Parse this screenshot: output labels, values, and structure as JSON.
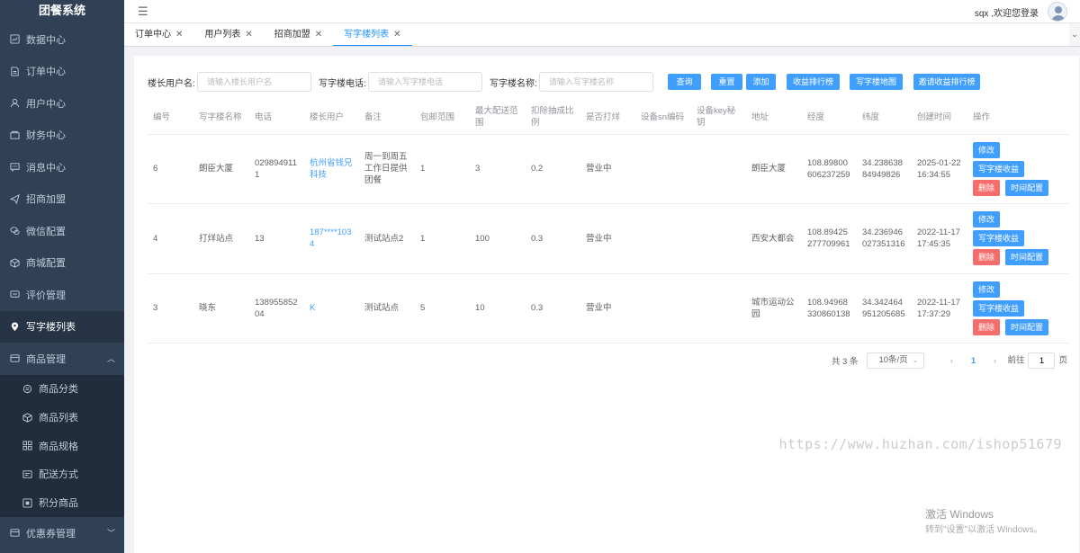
{
  "app_title": "团餐系统",
  "sidebar": {
    "items": [
      {
        "label": "数据中心",
        "icon": "dashboard-icon"
      },
      {
        "label": "订单中心",
        "icon": "document-icon"
      },
      {
        "label": "用户中心",
        "icon": "user-icon"
      },
      {
        "label": "财务中心",
        "icon": "wallet-icon"
      },
      {
        "label": "消息中心",
        "icon": "message-icon"
      },
      {
        "label": "招商加盟",
        "icon": "send-icon"
      },
      {
        "label": "微信配置",
        "icon": "wechat-icon"
      },
      {
        "label": "商城配置",
        "icon": "box-icon"
      },
      {
        "label": "评价管理",
        "icon": "comment-icon"
      },
      {
        "label": "写字楼列表",
        "icon": "location-icon"
      },
      {
        "label": "商品管理",
        "icon": "goods-icon"
      }
    ],
    "sub_items": [
      {
        "label": "商品分类",
        "icon": "category-icon"
      },
      {
        "label": "商品列表",
        "icon": "cube-icon"
      },
      {
        "label": "商品规格",
        "icon": "grid-icon"
      },
      {
        "label": "配送方式",
        "icon": "delivery-icon"
      },
      {
        "label": "积分商品",
        "icon": "points-icon"
      }
    ],
    "last_item": {
      "label": "优惠券管理",
      "icon": "coupon-icon"
    }
  },
  "header": {
    "welcome": "sqx ,欢迎您登录"
  },
  "tabs": [
    {
      "label": "订单中心"
    },
    {
      "label": "用户列表"
    },
    {
      "label": "招商加盟"
    },
    {
      "label": "写字楼列表"
    }
  ],
  "search": {
    "owner_label": "楼长用户名:",
    "owner_placeholder": "请输入楼长用户名",
    "phone_label": "写字楼电话:",
    "phone_placeholder": "请输入写字楼电话",
    "name_label": "写字楼名称:",
    "name_placeholder": "请输入写字楼名称",
    "buttons": {
      "query": "查询",
      "reset": "重置",
      "add": "添加",
      "revenue_rank": "收益排行榜",
      "map": "写字楼地图",
      "invite_rank": "邀请收益排行榜"
    }
  },
  "table": {
    "columns": [
      "编号",
      "写字楼名称",
      "电话",
      "楼长用户",
      "备注",
      "包邮范围",
      "最大配送范围",
      "扣除抽成比例",
      "是否打烊",
      "设备sn编码",
      "设备key秘钥",
      "地址",
      "经度",
      "纬度",
      "创建时间",
      "操作"
    ],
    "rows": [
      {
        "id": "6",
        "name": "朗臣大厦",
        "phone": "0298949111",
        "owner": "杭州省钱兄科技",
        "note": "周一到周五工作日提供团餐",
        "free_range": "1",
        "max_range": "3",
        "commission": "0.2",
        "status": "营业中",
        "sn": "",
        "key": "",
        "address": "朗臣大厦",
        "lng": "108.89800606237259",
        "lat": "34.23863884949826",
        "created": "2025-01-22 16:34:55"
      },
      {
        "id": "4",
        "name": "打烊站点",
        "phone": "13",
        "owner": "187****1034",
        "note": "测试站点2",
        "free_range": "1",
        "max_range": "100",
        "commission": "0.3",
        "status": "营业中",
        "sn": "",
        "key": "",
        "address": "西安大都会",
        "lng": "108.89425277709961",
        "lat": "34.236946027351316",
        "created": "2022-11-17 17:45:35"
      },
      {
        "id": "3",
        "name": "晓东",
        "phone": "13895585204",
        "owner": "K",
        "note": "测试站点",
        "free_range": "5",
        "max_range": "10",
        "commission": "0.3",
        "status": "营业中",
        "sn": "",
        "key": "",
        "address": "城市运动公园",
        "lng": "108.94968330860138",
        "lat": "34.342464951205685",
        "created": "2022-11-17 17:37:29"
      }
    ],
    "ops": {
      "edit": "修改",
      "revenue": "写字楼收益",
      "delete": "删除",
      "time": "时间配置"
    }
  },
  "pagination": {
    "total": "共 3 条",
    "page_size": "10条/页",
    "current": "1",
    "goto_label": "前往",
    "goto_value": "1",
    "page_suffix": "页"
  },
  "watermark": "https://www.huzhan.com/ishop51679",
  "windows_activation": {
    "title": "激活 Windows",
    "subtitle": "转到\"设置\"以激活 Windows。"
  }
}
